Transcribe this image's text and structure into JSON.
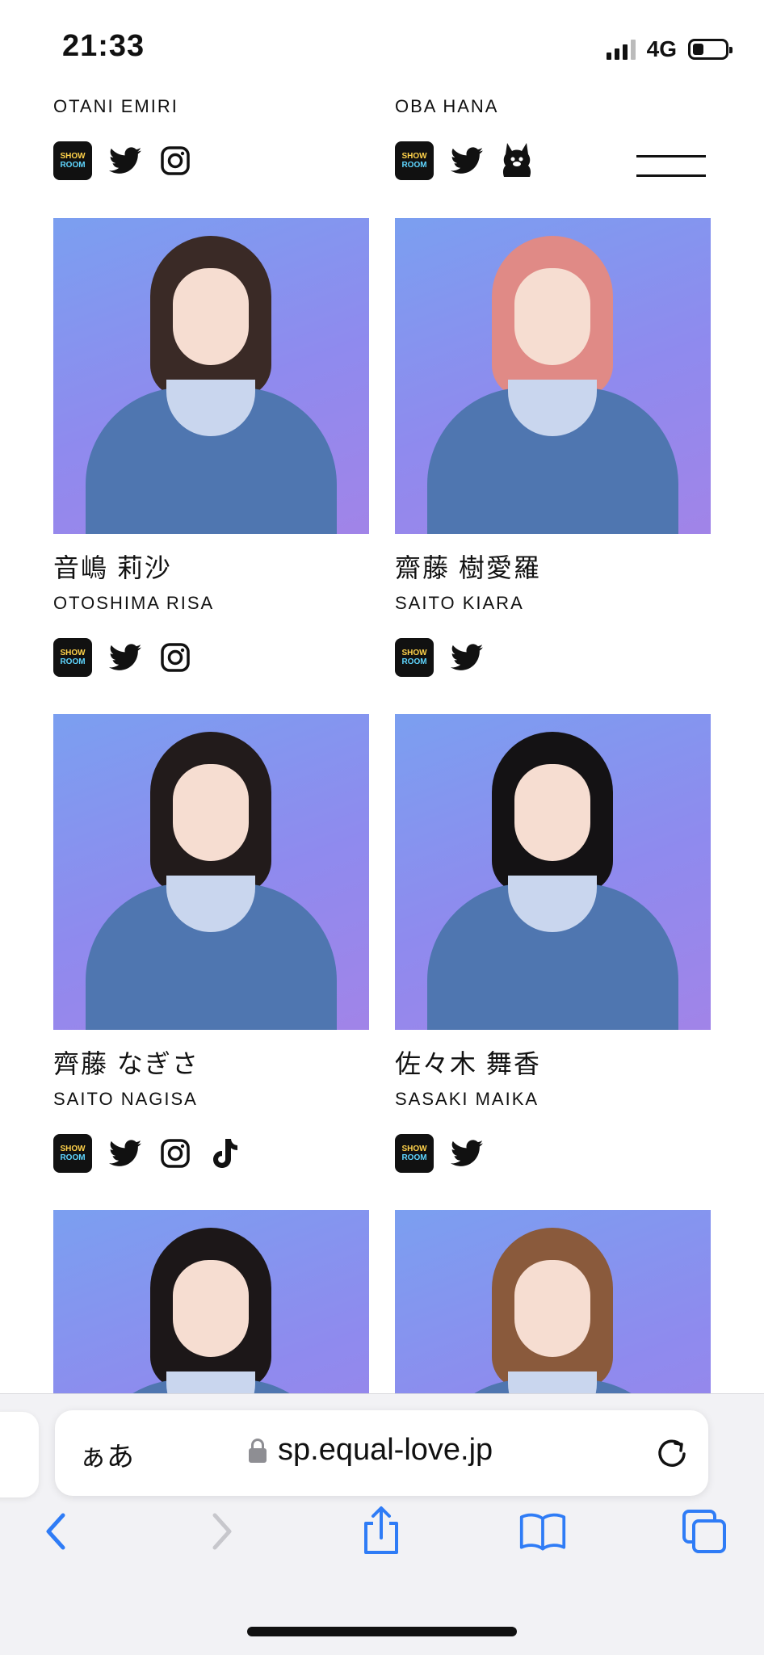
{
  "status_bar": {
    "time": "21:33",
    "network": "4G",
    "battery_level": 0.35
  },
  "colors": {
    "accent": "#2f7cf6",
    "disabled": "#c7c7cc",
    "photo_gradient": [
      "#7b9ff0",
      "#a184e8"
    ]
  },
  "members_top": [
    {
      "name_en": "OTANI EMIRI",
      "socials": [
        "showroom-icon",
        "twitter-icon",
        "instagram-icon"
      ]
    },
    {
      "name_en": "OBA HANA",
      "socials": [
        "showroom-icon",
        "twitter-icon",
        "character-icon"
      ]
    }
  ],
  "members": [
    {
      "name_jp": "音嶋 莉沙",
      "name_en": "OTOSHIMA RISA",
      "socials": [
        "showroom-icon",
        "twitter-icon",
        "instagram-icon"
      ],
      "hair": "#3a2a26"
    },
    {
      "name_jp": "齋藤 樹愛羅",
      "name_en": "SAITO KIARA",
      "socials": [
        "showroom-icon",
        "twitter-icon"
      ],
      "hair": "#e08a86"
    },
    {
      "name_jp": "齊藤 なぎさ",
      "name_en": "SAITO NAGISA",
      "socials": [
        "showroom-icon",
        "twitter-icon",
        "instagram-icon",
        "tiktok-icon"
      ],
      "hair": "#221b1b"
    },
    {
      "name_jp": "佐々木 舞香",
      "name_en": "SASAKI MAIKA",
      "socials": [
        "showroom-icon",
        "twitter-icon"
      ],
      "hair": "#141214"
    },
    {
      "hair": "#1c1718"
    },
    {
      "hair": "#8a5a3c"
    }
  ],
  "showroom_label": {
    "line1": "SHOW",
    "line2": "ROOM"
  },
  "browser": {
    "aa_label": "ぁあ",
    "url": "sp.equal-love.jp",
    "nav": [
      "back-icon",
      "forward-icon",
      "share-icon",
      "bookmarks-icon",
      "tabs-icon"
    ]
  }
}
